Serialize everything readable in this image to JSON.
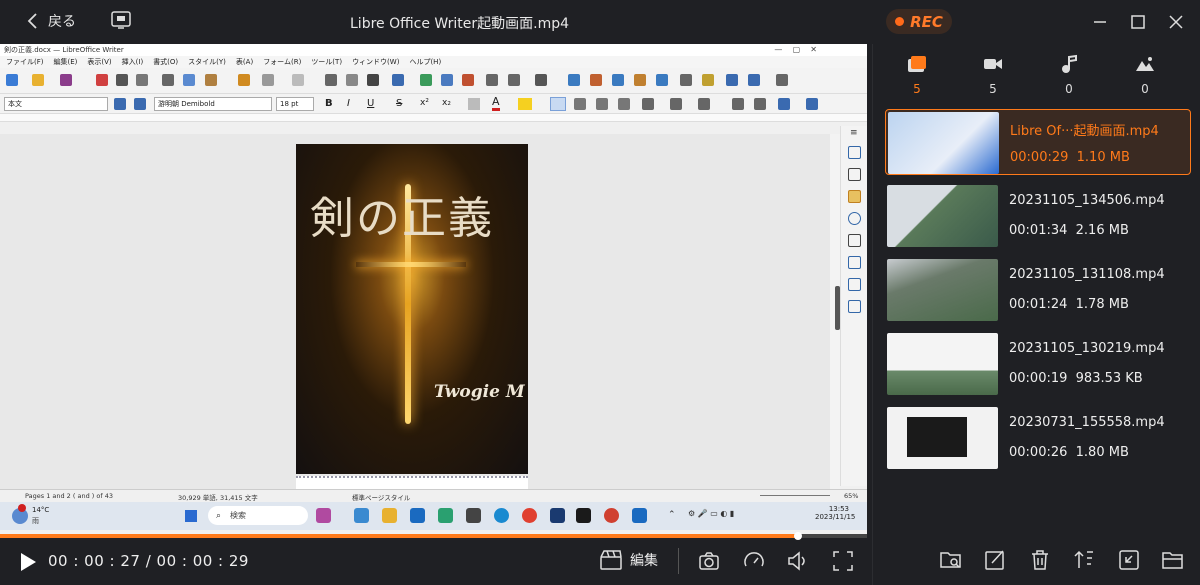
{
  "header": {
    "back_label": "戻る",
    "title": "Libre Office Writer起動画面.mp4",
    "rec_label": "REC"
  },
  "libreoffice": {
    "window_title": "剣の正義.docx — LibreOffice Writer",
    "menu": [
      "ファイル(F)",
      "編集(E)",
      "表示(V)",
      "挿入(I)",
      "書式(O)",
      "スタイル(Y)",
      "表(A)",
      "フォーム(R)",
      "ツール(T)",
      "ウィンドウ(W)",
      "ヘルプ(H)"
    ],
    "para_style": "本文",
    "font_name": "游明朝 Demibold",
    "font_size": "18 pt",
    "cover_title": "剣の正義",
    "cover_author": "Twogie M",
    "status_pages": "Pages 1 and 2 ( and ) of 43",
    "status_words": "30,929 単語, 31,415 文字",
    "status_style": "標準ページスタイル",
    "status_zoom": "65%"
  },
  "windows_taskbar": {
    "weather_temp": "14°C",
    "weather_desc": "雨",
    "search_placeholder": "検索",
    "clock_time": "13:53",
    "clock_date": "2023/11/15"
  },
  "playback": {
    "progress_fraction": 0.92,
    "time_display": "00 : 00 : 27 / 00 : 00 : 29",
    "edit_label": "編集"
  },
  "categories": [
    {
      "icon": "video-folder-icon",
      "count": "5",
      "active": true
    },
    {
      "icon": "camera-icon",
      "count": "5",
      "active": false
    },
    {
      "icon": "music-note-icon",
      "count": "0",
      "active": false
    },
    {
      "icon": "image-icon",
      "count": "0",
      "active": false
    }
  ],
  "recordings": [
    {
      "name": "Libre Of···起動画面.mp4",
      "duration": "00:00:29",
      "size": "1.10 MB",
      "active": true
    },
    {
      "name": "20231105_134506.mp4",
      "duration": "00:01:34",
      "size": "2.16 MB",
      "active": false
    },
    {
      "name": "20231105_131108.mp4",
      "duration": "00:01:24",
      "size": "1.78 MB",
      "active": false
    },
    {
      "name": "20231105_130219.mp4",
      "duration": "00:00:19",
      "size": "983.53 KB",
      "active": false
    },
    {
      "name": "20230731_155558.mp4",
      "duration": "00:00:26",
      "size": "1.80 MB",
      "active": false
    }
  ],
  "colors": {
    "accent": "#ff7a1a",
    "background": "#1f2024"
  }
}
